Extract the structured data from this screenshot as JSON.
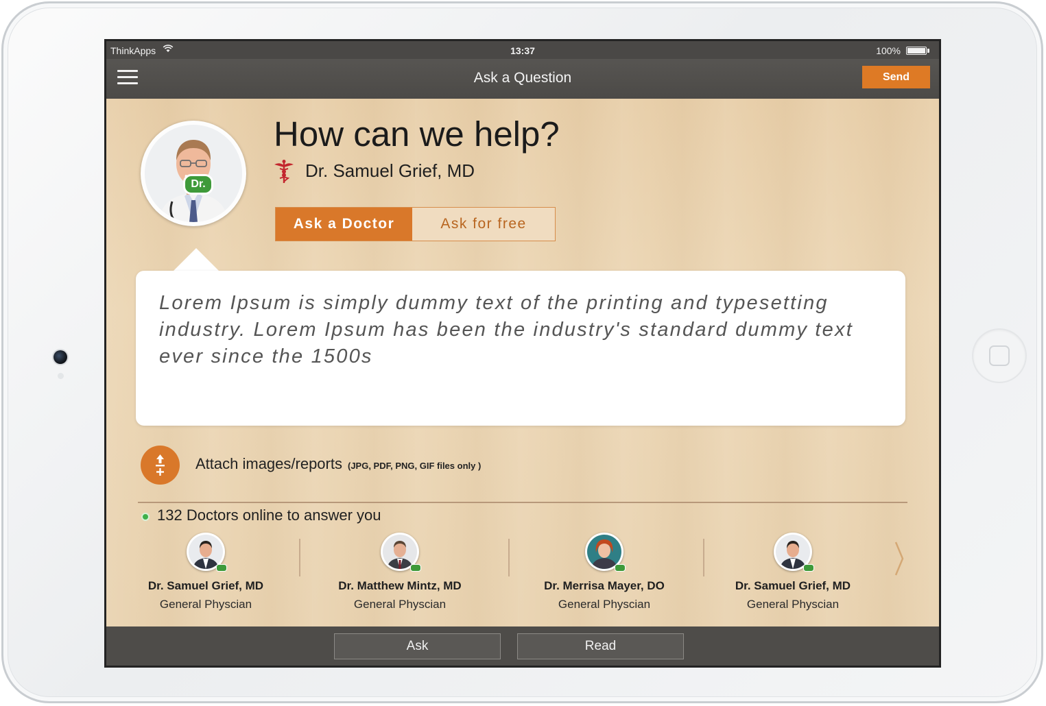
{
  "status_bar": {
    "carrier": "ThinkApps",
    "time": "13:37",
    "battery_percent": "100%"
  },
  "nav": {
    "title": "Ask a Question",
    "send_label": "Send"
  },
  "header": {
    "headline": "How can we help?",
    "doctor_name": "Dr. Samuel Grief, MD",
    "badge": "Dr."
  },
  "mode_toggle": {
    "options": [
      {
        "label": "Ask a Doctor",
        "selected": true
      },
      {
        "label": "Ask for free",
        "selected": false
      }
    ]
  },
  "question": {
    "text": "Lorem Ipsum is simply dummy text of the printing and typesetting industry. Lorem Ipsum has been the industry's standard dummy text ever since the 1500s"
  },
  "attach": {
    "label": "Attach images/reports",
    "note": "(JPG, PDF, PNG, GIF files only )"
  },
  "online": {
    "text": "132 Doctors online to answer you"
  },
  "doctors": [
    {
      "name": "Dr. Samuel Grief, MD",
      "role": "General Physcian"
    },
    {
      "name": "Dr. Matthew Mintz, MD",
      "role": "General Physcian"
    },
    {
      "name": "Dr. Merrisa Mayer, DO",
      "role": "General Physcian"
    },
    {
      "name": "Dr. Samuel Grief, MD",
      "role": "General Physcian"
    }
  ],
  "bottom_nav": {
    "ask_label": "Ask",
    "read_label": "Read"
  },
  "colors": {
    "accent": "#d9782a",
    "online": "#3fb04a",
    "badge": "#3e9a3a",
    "bar": "#4e4c49"
  }
}
